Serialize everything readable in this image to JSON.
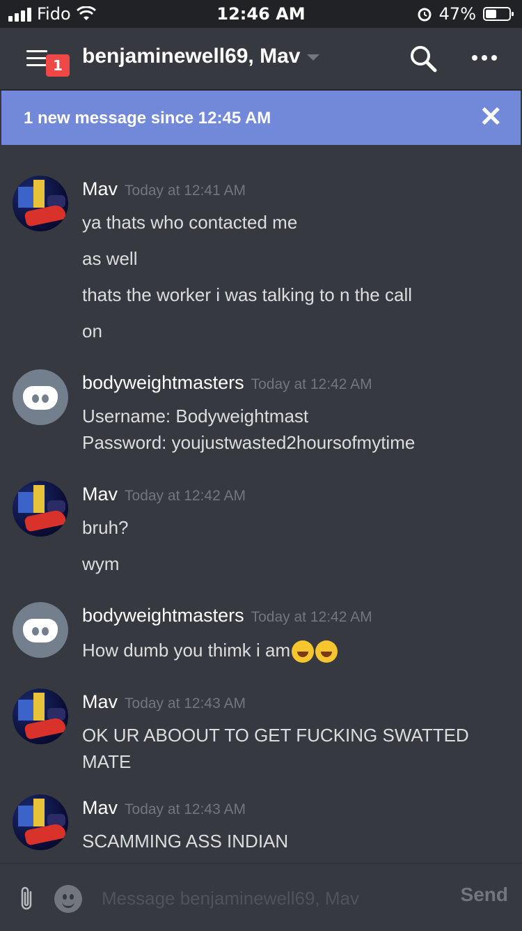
{
  "status_bar": {
    "carrier": "Fido",
    "time": "12:46 AM",
    "battery": "47%",
    "battery_level": 0.47,
    "icons": [
      "signal-icon",
      "wifi-icon",
      "alarm-icon",
      "battery-icon"
    ]
  },
  "header": {
    "title": "benjaminewell69, Mav",
    "unread_badge": "1",
    "icons": [
      "hamburger-icon",
      "search-icon",
      "more-icon"
    ]
  },
  "banner": {
    "text": "1 new message since 12:45 AM",
    "close": "✕"
  },
  "messages": [
    {
      "author": "Mav",
      "time": "Today at 12:41 AM",
      "avatar": "photo",
      "lines": [
        "ya thats who contacted me",
        "as well",
        "thats the worker i was talking to n the call",
        "on"
      ]
    },
    {
      "author": "bodyweightmasters",
      "time": "Today at 12:42 AM",
      "avatar": "discord-default",
      "lines": [
        "Username: Bodyweightmast",
        "Password: youjustwasted2hoursofmytime"
      ]
    },
    {
      "author": "Mav",
      "time": "Today at 12:42 AM",
      "avatar": "photo",
      "lines": [
        "bruh?",
        "wym"
      ]
    },
    {
      "author": "bodyweightmasters",
      "time": "Today at 12:42 AM",
      "avatar": "discord-default",
      "lines": [
        "How dumb you thimk i am"
      ],
      "emoji": [
        "rofl-emoji",
        "rofl-emoji"
      ]
    },
    {
      "author": "Mav",
      "time": "Today at 12:43 AM",
      "avatar": "photo",
      "lines": [
        "OK UR ABOOUT TO GET FUCKING SWATTED",
        "MATE"
      ]
    },
    {
      "author": "Mav",
      "time": "Today at 12:43 AM",
      "avatar": "photo",
      "lines": [
        "SCAMMING ASS INDIAN"
      ]
    }
  ],
  "composer": {
    "placeholder": "Message benjaminewell69, Mav",
    "value": "",
    "send_label": "Send"
  },
  "colors": {
    "background": "#36393f",
    "status_bar": "#202225",
    "banner": "#7289da",
    "badge": "#f04747",
    "text": "#dcddde",
    "muted": "#72767d"
  }
}
